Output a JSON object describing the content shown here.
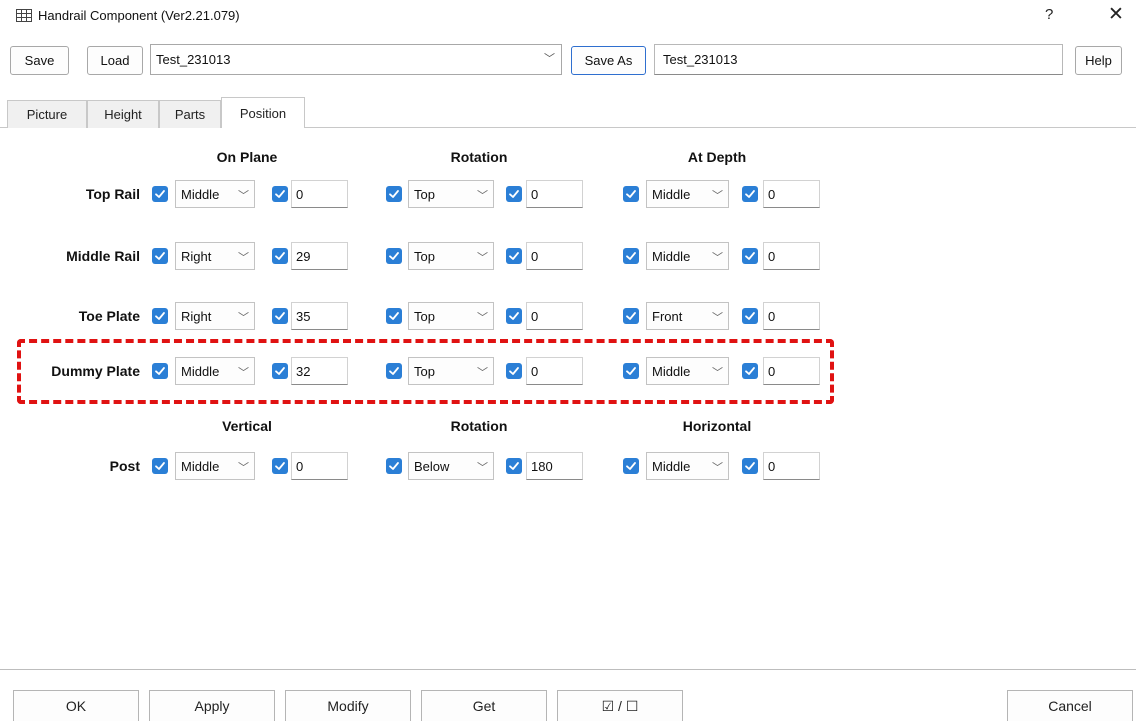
{
  "window": {
    "title": "Handrail Component (Ver2.21.079)",
    "help_glyph": "?",
    "close_glyph": "✕",
    "app_icon": "grid-icon"
  },
  "toolbar": {
    "save_label": "Save",
    "load_label": "Load",
    "preset_value": "Test_231013",
    "save_as_label": "Save As",
    "save_as_value": "Test_231013",
    "help_label": "Help"
  },
  "tabs": [
    {
      "label": "Picture"
    },
    {
      "label": "Height"
    },
    {
      "label": "Parts"
    },
    {
      "label": "Position",
      "active": true
    }
  ],
  "headers": {
    "col1": "On Plane",
    "col2": "Rotation",
    "col3": "At Depth"
  },
  "rows": [
    {
      "label": "Top Rail",
      "c1": "Middle",
      "v1": "0",
      "c2": "Top",
      "v2": "0",
      "c3": "Middle",
      "v3": "0"
    },
    {
      "label": "Middle Rail",
      "c1": "Right",
      "v1": "29",
      "c2": "Top",
      "v2": "0",
      "c3": "Middle",
      "v3": "0"
    },
    {
      "label": "Toe Plate",
      "c1": "Right",
      "v1": "35",
      "c2": "Top",
      "v2": "0",
      "c3": "Front",
      "v3": "0"
    },
    {
      "label": "Dummy Plate",
      "c1": "Middle",
      "v1": "32",
      "c2": "Top",
      "v2": "0",
      "c3": "Middle",
      "v3": "0"
    }
  ],
  "post_headers": {
    "col1": "Vertical",
    "col2": "Rotation",
    "col3": "Horizontal"
  },
  "post": {
    "label": "Post",
    "c1": "Middle",
    "v1": "0",
    "c2": "Below",
    "v2": "180",
    "c3": "Middle",
    "v3": "0"
  },
  "checkboxes_checked": true,
  "highlight_color": "#e01212",
  "accent_color": "#2b7fd6",
  "bottom": {
    "ok_label": "OK",
    "apply_label": "Apply",
    "modify_label": "Modify",
    "get_label": "Get",
    "toggle_label": "☑ / ☐",
    "cancel_label": "Cancel"
  }
}
